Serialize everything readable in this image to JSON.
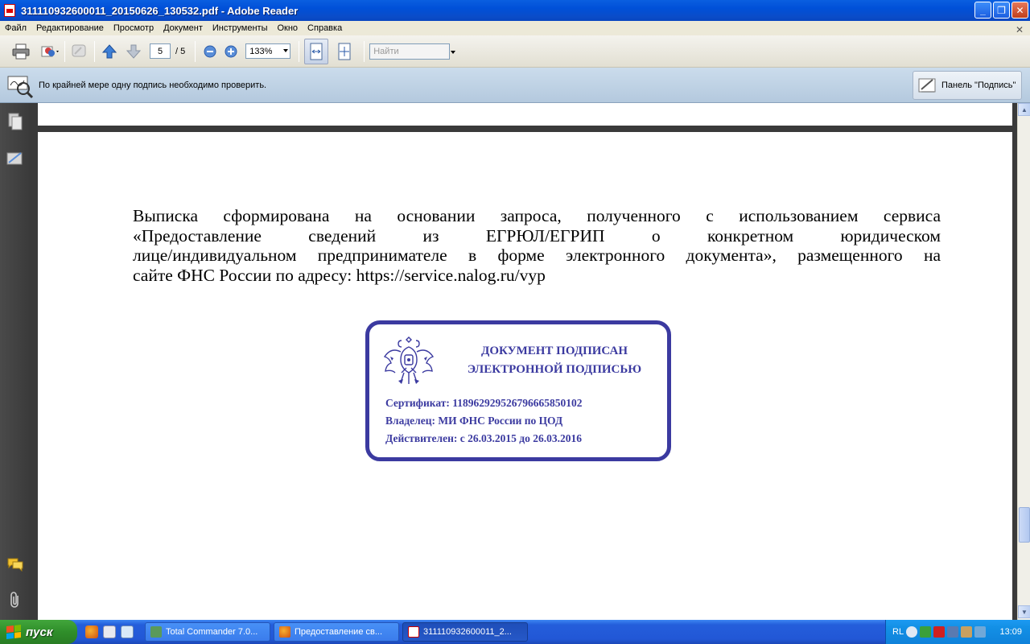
{
  "window": {
    "title": "311110932600011_20150626_130532.pdf - Adobe Reader",
    "minimize": "_",
    "maximize": "❐",
    "close": "✕"
  },
  "menu": [
    "Файл",
    "Редактирование",
    "Просмотр",
    "Документ",
    "Инструменты",
    "Окно",
    "Справка"
  ],
  "toolbar": {
    "page_current": "5",
    "page_total": "/ 5",
    "zoom": "133%",
    "find_placeholder": "Найти"
  },
  "message_bar": {
    "text": "По крайней мере одну подпись необходимо проверить.",
    "sign_panel_button": "Панель \"Подпись\""
  },
  "document": {
    "paragraph_lines": [
      "Выписка сформирована на основании запроса, полученного с использованием сервиса",
      "«Предоставление сведений из ЕГРЮЛ/ЕГРИП о конкретном юридическом",
      "лице/индивидуальном предпринимателе в форме электронного документа», размещенного на",
      "сайте ФНС России по адресу: https://service.nalog.ru/vyp"
    ],
    "stamp": {
      "title_line1": "ДОКУМЕНТ ПОДПИСАН",
      "title_line2": "ЭЛЕКТРОННОЙ ПОДПИСЬЮ",
      "certificate": "Сертификат: 118962929526796665850102",
      "owner": "Владелец: МИ ФНС России по ЦОД",
      "valid": "Действителен: с 26.03.2015 до 26.03.2016"
    }
  },
  "taskbar": {
    "start": "пуск",
    "tasks": [
      {
        "label": "Total Commander 7.0...",
        "active": false
      },
      {
        "label": "Предоставление св...",
        "active": false
      },
      {
        "label": "311110932600011_2...",
        "active": true
      }
    ],
    "tray_lang": "RL",
    "clock": "13:09"
  },
  "colors": {
    "stamp_blue": "#3b3aa0",
    "title_blue": "#0054e3",
    "start_green": "#2f8e2a"
  }
}
